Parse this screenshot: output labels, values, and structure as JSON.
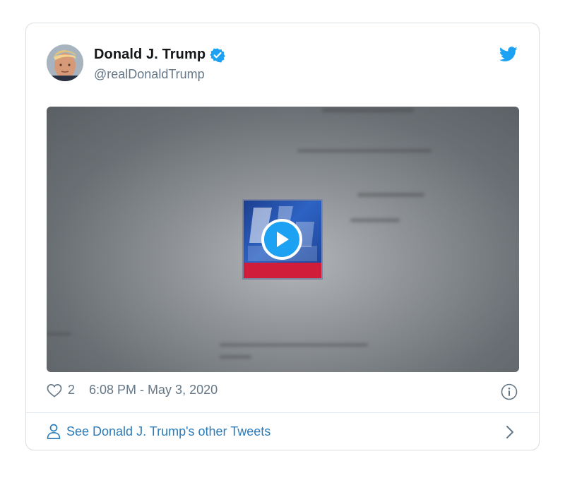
{
  "tweet": {
    "author_name": "Donald J. Trump",
    "handle": "@realDonaldTrump",
    "like_count": "2",
    "timestamp": "6:08 PM - May 3, 2020",
    "see_more": "See Donald J. Trump's other Tweets"
  },
  "icons": {
    "avatar": "avatar",
    "verified": "verified-badge-icon",
    "brand": "twitter-bird-icon",
    "like": "heart-icon",
    "play": "play-icon",
    "info": "info-icon",
    "person": "person-icon",
    "chevron": "chevron-right-icon"
  },
  "colors": {
    "accent": "#1da1f2",
    "link": "#2b7bb9",
    "muted": "#657786",
    "border": "#d8dee2"
  }
}
